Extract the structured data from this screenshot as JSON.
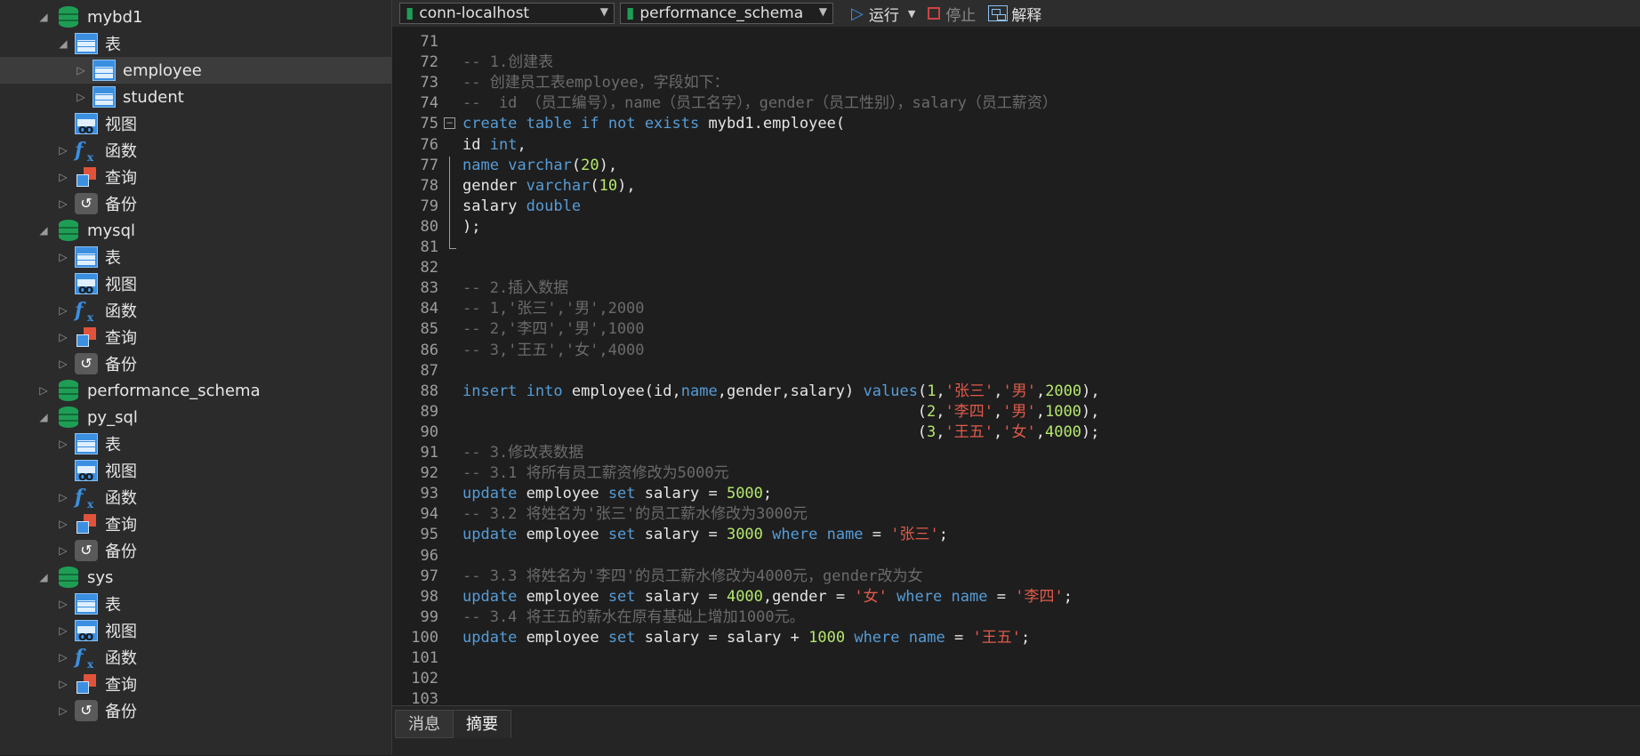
{
  "sidebar": {
    "items": [
      {
        "label": "mybd1",
        "type": "db",
        "expanded": true
      },
      {
        "label": "表",
        "type": "table",
        "expanded": true
      },
      {
        "label": "employee",
        "type": "table",
        "selected": true
      },
      {
        "label": "student",
        "type": "table"
      },
      {
        "label": "视图",
        "type": "view"
      },
      {
        "label": "函数",
        "type": "function"
      },
      {
        "label": "查询",
        "type": "query"
      },
      {
        "label": "备份",
        "type": "backup"
      },
      {
        "label": "mysql",
        "type": "db",
        "expanded": true
      },
      {
        "label": "表",
        "type": "table"
      },
      {
        "label": "视图",
        "type": "view"
      },
      {
        "label": "函数",
        "type": "function"
      },
      {
        "label": "查询",
        "type": "query"
      },
      {
        "label": "备份",
        "type": "backup"
      },
      {
        "label": "performance_schema",
        "type": "db"
      },
      {
        "label": "py_sql",
        "type": "db",
        "expanded": true
      },
      {
        "label": "表",
        "type": "table"
      },
      {
        "label": "视图",
        "type": "view"
      },
      {
        "label": "函数",
        "type": "function"
      },
      {
        "label": "查询",
        "type": "query"
      },
      {
        "label": "备份",
        "type": "backup"
      },
      {
        "label": "sys",
        "type": "db",
        "expanded": true
      },
      {
        "label": "表",
        "type": "table"
      },
      {
        "label": "视图",
        "type": "view"
      },
      {
        "label": "函数",
        "type": "function"
      },
      {
        "label": "查询",
        "type": "query"
      },
      {
        "label": "备份",
        "type": "backup"
      }
    ]
  },
  "toolbar": {
    "connection": "conn-localhost",
    "schema": "performance_schema",
    "run_label": "运行",
    "stop_label": "停止",
    "explain_label": "解释"
  },
  "editor": {
    "lines": [
      {
        "num": "71",
        "text": ""
      },
      {
        "num": "72",
        "text": "-- 1.创建表"
      },
      {
        "num": "73",
        "text": "-- 创建员工表employee，字段如下："
      },
      {
        "num": "74",
        "text": "--  id （员工编号），name（员工名字），gender（员工性别），salary（员工薪资）"
      },
      {
        "num": "75",
        "text": "create table if not exists mybd1.employee("
      },
      {
        "num": "76",
        "text": "id int,"
      },
      {
        "num": "77",
        "text": "name varchar(20),"
      },
      {
        "num": "78",
        "text": "gender varchar(10),"
      },
      {
        "num": "79",
        "text": "salary double"
      },
      {
        "num": "80",
        "text": ");"
      },
      {
        "num": "81",
        "text": ""
      },
      {
        "num": "82",
        "text": ""
      },
      {
        "num": "83",
        "text": "-- 2.插入数据"
      },
      {
        "num": "84",
        "text": "-- 1,'张三','男',2000"
      },
      {
        "num": "85",
        "text": "-- 2,'李四','男',1000"
      },
      {
        "num": "86",
        "text": "-- 3,'王五','女',4000"
      },
      {
        "num": "87",
        "text": ""
      },
      {
        "num": "88",
        "text": "insert into employee(id,name,gender,salary) values(1,'张三','男',2000),"
      },
      {
        "num": "89",
        "text": "                                                  (2,'李四','男',1000),"
      },
      {
        "num": "90",
        "text": "                                                  (3,'王五','女',4000);"
      },
      {
        "num": "91",
        "text": "-- 3.修改表数据"
      },
      {
        "num": "92",
        "text": "-- 3.1 将所有员工薪资修改为5000元"
      },
      {
        "num": "93",
        "text": "update employee set salary = 5000;"
      },
      {
        "num": "94",
        "text": "-- 3.2 将姓名为'张三'的员工薪水修改为3000元"
      },
      {
        "num": "95",
        "text": "update employee set salary = 3000 where name = '张三';"
      },
      {
        "num": "96",
        "text": ""
      },
      {
        "num": "97",
        "text": "-- 3.3 将姓名为'李四'的员工薪水修改为4000元，gender改为女"
      },
      {
        "num": "98",
        "text": "update employee set salary = 4000,gender = '女' where name = '李四';"
      },
      {
        "num": "99",
        "text": "-- 3.4 将王五的薪水在原有基础上增加1000元。"
      },
      {
        "num": "100",
        "text": "update employee set salary = salary + 1000 where name = '王五';"
      },
      {
        "num": "101",
        "text": ""
      },
      {
        "num": "102",
        "text": ""
      },
      {
        "num": "103",
        "text": ""
      }
    ]
  },
  "bottom_tabs": {
    "messages": "消息",
    "summary": "摘要"
  },
  "colors": {
    "keyword": "#569cd6",
    "number": "#b5e86e",
    "string": "#e05a4a",
    "comment": "#6b6b6b",
    "db_icon": "#1e9e55"
  }
}
